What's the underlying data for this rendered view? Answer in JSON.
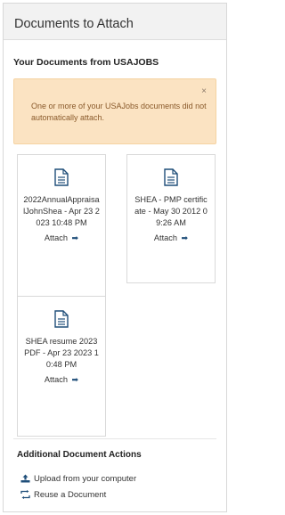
{
  "panel": {
    "title": "Documents to Attach"
  },
  "section_title": "Your Documents from USAJOBS",
  "alert": {
    "message": "One or more of your USAJobs documents did not automatically attach.",
    "close_glyph": "×"
  },
  "documents": [
    {
      "name": "2022AnnualAppraisalJohnShea - Apr 23 2023 10:48 PM",
      "attach_label": "Attach",
      "arrow": "➡",
      "icon": "document-icon"
    },
    {
      "name": "SHEA - PMP certificate - May 30 2012 09:26 AM",
      "attach_label": "Attach",
      "arrow": "➡",
      "icon": "document-icon"
    },
    {
      "name": "SHEA resume 2023 PDF - Apr 23 2023 10:48 PM",
      "attach_label": "Attach",
      "arrow": "➡",
      "icon": "document-icon"
    }
  ],
  "actions": {
    "title": "Additional Document Actions",
    "upload_label": "Upload from your computer",
    "upload_icon": "upload-icon",
    "reuse_label": "Reuse a Document",
    "reuse_icon": "reuse-icon"
  },
  "colors": {
    "alert_bg": "#fbe3c2",
    "alert_text": "#8a5a2b",
    "icon_blue": "#1f4e79",
    "header_bg": "#f2f2f2"
  }
}
